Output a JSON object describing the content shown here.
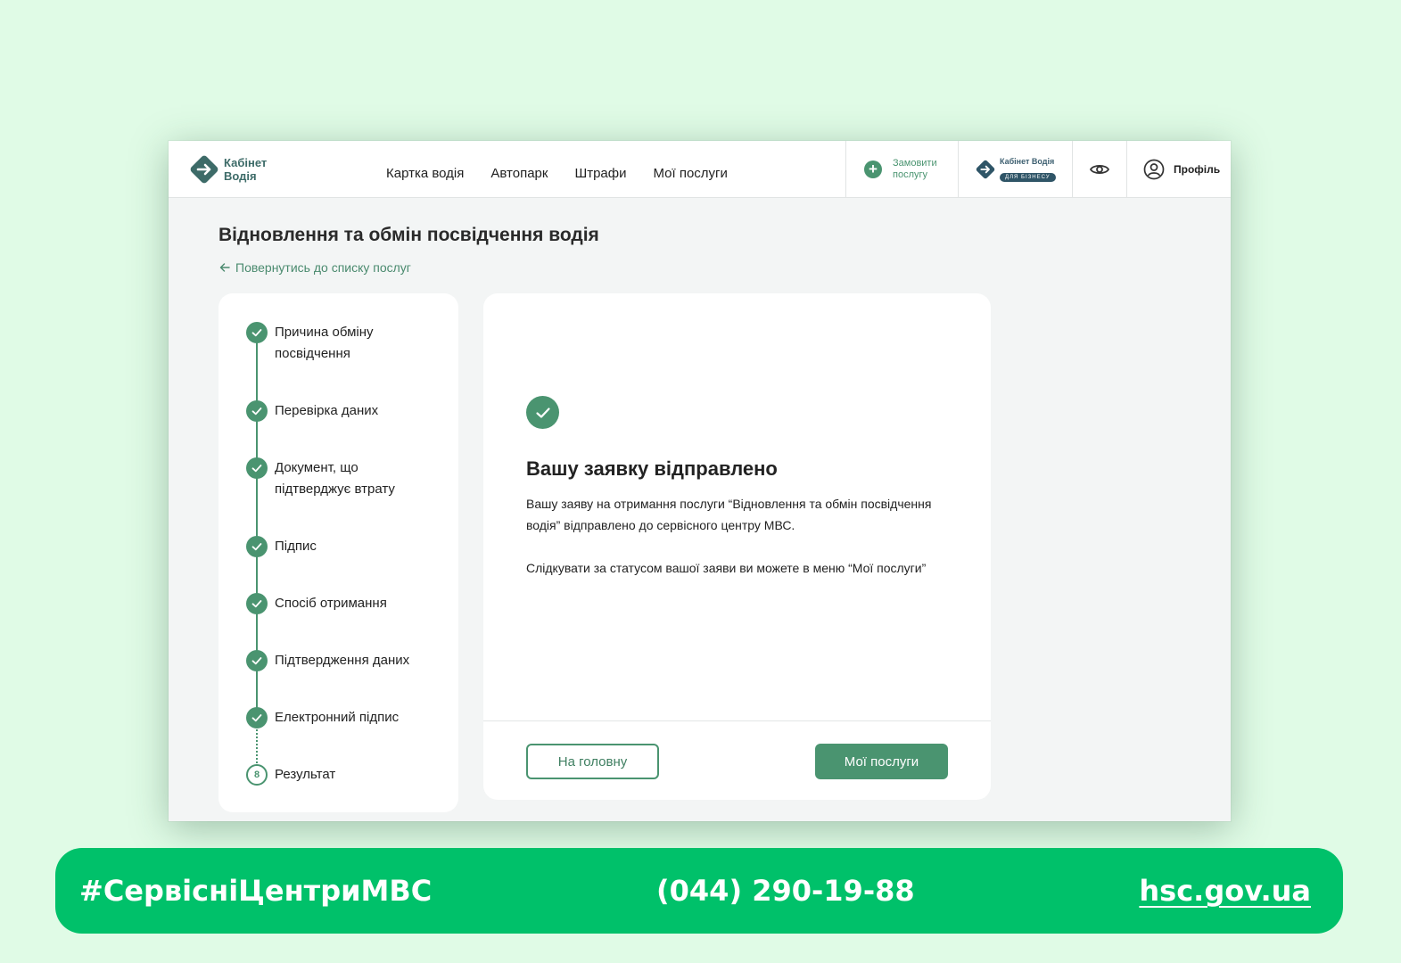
{
  "header": {
    "logo_line1": "Кабінет",
    "logo_line2": "Водія",
    "nav": [
      "Картка водія",
      "Автопарк",
      "Штрафи",
      "Мої послуги"
    ],
    "order_line1": "Замовити",
    "order_line2": "послугу",
    "biz_title": "Кабінет Водія",
    "biz_badge": "ДЛЯ БІЗНЕСУ",
    "profile_label": "Профіль"
  },
  "page": {
    "title": "Відновлення та обмін посвідчення водія",
    "back_link": "Повернутись до списку послуг"
  },
  "steps": [
    {
      "label": "Причина обміну посвідчення",
      "status": "done"
    },
    {
      "label": "Перевірка даних",
      "status": "done"
    },
    {
      "label": "Документ, що підтверджує втрату",
      "status": "done"
    },
    {
      "label": "Підпис",
      "status": "done"
    },
    {
      "label": "Спосіб отримання",
      "status": "done"
    },
    {
      "label": "Підтвердження даних",
      "status": "done"
    },
    {
      "label": "Електронний підпис",
      "status": "done"
    },
    {
      "label": "Результат",
      "status": "current",
      "number": "8"
    }
  ],
  "result": {
    "title": "Вашу заявку відправлено",
    "text": "Вашу заяву на отримання послуги “Відновлення та обмін посвідчення водія” відправлено до сервісного центру МВС.",
    "hint": "Слідкувати за статусом вашої заяви ви можете в меню “Мої послуги”",
    "home_button": "На головну",
    "services_button": "Мої послуги"
  },
  "banner": {
    "hashtag": "#СервісніЦентриМВС",
    "phone": "(044) 290-19-88",
    "url": "hsc.gov.ua"
  },
  "colors": {
    "accent": "#4a9470",
    "banner": "#00c16a",
    "background": "#e0fbe6"
  },
  "icons": [
    "logo-arrow-icon",
    "plus-icon",
    "eye-icon",
    "user-icon",
    "check-icon",
    "arrow-left-icon"
  ]
}
